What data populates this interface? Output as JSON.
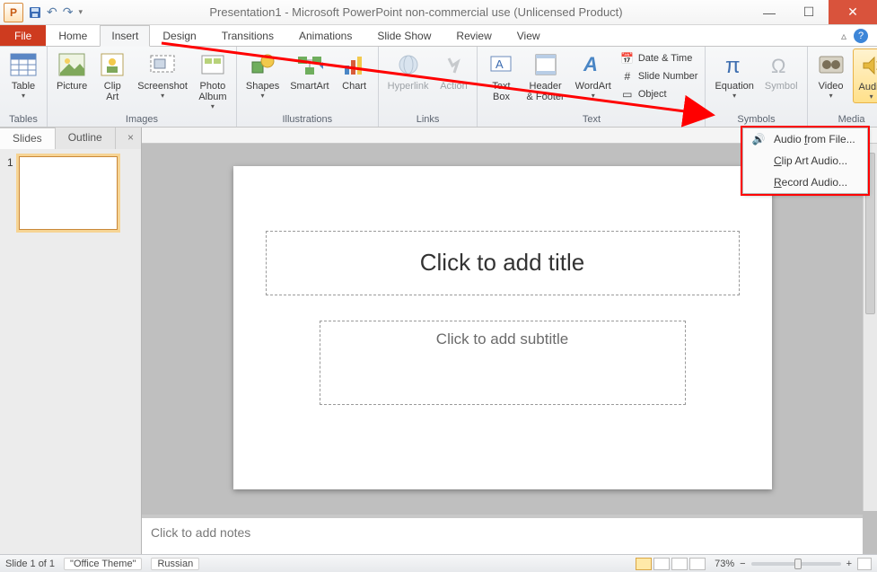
{
  "title": "Presentation1 - Microsoft PowerPoint non-commercial use (Unlicensed Product)",
  "app_icon_letter": "P",
  "tabs": {
    "file": "File",
    "home": "Home",
    "insert": "Insert",
    "design": "Design",
    "transitions": "Transitions",
    "animations": "Animations",
    "slideshow": "Slide Show",
    "review": "Review",
    "view": "View"
  },
  "groups": {
    "tables": "Tables",
    "images": "Images",
    "illustrations": "Illustrations",
    "links": "Links",
    "text": "Text",
    "symbols": "Symbols",
    "media": "Media"
  },
  "buttons": {
    "table": "Table",
    "picture": "Picture",
    "clipart": "Clip\nArt",
    "screenshot": "Screenshot",
    "photoalbum": "Photo\nAlbum",
    "shapes": "Shapes",
    "smartart": "SmartArt",
    "chart": "Chart",
    "hyperlink": "Hyperlink",
    "action": "Action",
    "textbox": "Text\nBox",
    "headerfooter": "Header\n& Footer",
    "wordart": "WordArt",
    "datetime": "Date & Time",
    "slidenumber": "Slide Number",
    "object": "Object",
    "equation": "Equation",
    "symbol": "Symbol",
    "video": "Video",
    "audio": "Audio"
  },
  "audio_menu": {
    "from_file": "Audio from File...",
    "clip_art": "Clip Art Audio...",
    "record": "Record Audio..."
  },
  "sidepane": {
    "slides": "Slides",
    "outline": "Outline",
    "thumb_number": "1"
  },
  "slide": {
    "title_placeholder": "Click to add title",
    "subtitle_placeholder": "Click to add subtitle"
  },
  "notes_placeholder": "Click to add notes",
  "status": {
    "slide_of": "Slide 1 of 1",
    "theme": "\"Office Theme\"",
    "lang": "Russian",
    "zoom": "73%"
  }
}
